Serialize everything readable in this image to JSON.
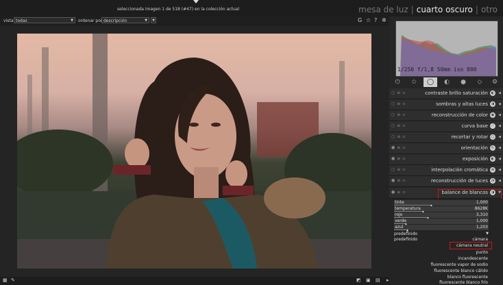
{
  "header": {
    "status": "seleccionada imagen 1 de 518 (#47) en la colección actual",
    "views": {
      "lighttable": "mesa de luz",
      "darkroom": "cuarto oscuro",
      "other": "otro"
    }
  },
  "filterbar": {
    "view_label": "vista",
    "view_value": "todas",
    "sort_label": "ordenar por",
    "sort_value": "descripción",
    "icons": {
      "g": "G",
      "star": "☆",
      "help": "?",
      "gear": "✲"
    }
  },
  "histogram": {
    "info": "1/250 f/1,8 50mm iso 800"
  },
  "module_tabs": [
    "⏻",
    "✩",
    "◯",
    "◐",
    "●",
    "◇",
    "⚙"
  ],
  "modules": [
    {
      "name": "contraste brillo saturación",
      "icon": "◐"
    },
    {
      "name": "sombras y altas luces",
      "icon": "◑"
    },
    {
      "name": "reconstrucción de color",
      "icon": "◉"
    },
    {
      "name": "curva base",
      "icon": "⟋"
    },
    {
      "name": "recortar y rotar",
      "icon": "▢"
    },
    {
      "name": "orientación",
      "icon": "↻"
    },
    {
      "name": "exposición",
      "icon": "◐"
    },
    {
      "name": "interpolación cromática",
      "icon": "⊕"
    },
    {
      "name": "reconstrucción de luces",
      "icon": "◔"
    },
    {
      "name": "balance de blancos",
      "icon": "◑"
    }
  ],
  "whitebalance": {
    "sliders": [
      {
        "name": "tinte",
        "value": "1,000"
      },
      {
        "name": "temperatura",
        "value": "8628K"
      },
      {
        "name": "rojo",
        "value": "3,310"
      },
      {
        "name": "verde",
        "value": "1,000"
      },
      {
        "name": "azul",
        "value": "1,203"
      }
    ],
    "preset_label": "predefinido",
    "preset_label2": "predefinido",
    "preset_options": [
      "cámara",
      "cámara neutral",
      "punto",
      "incandescente",
      "fluorescente vapor de sodio",
      "fluorescente blanco cálido",
      "blanco fluorescente",
      "fluorescente blanco frío"
    ]
  },
  "colors": {
    "highlight": "#d01515",
    "panel": "#262626",
    "background": "#1f1f1f"
  }
}
